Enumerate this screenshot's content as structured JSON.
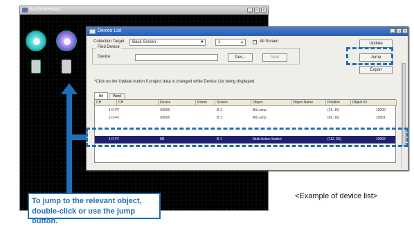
{
  "left_window": {
    "title": "B-1(Front+Back)",
    "controls": [
      "_",
      "□",
      "×"
    ]
  },
  "device_list": {
    "title": "Device List",
    "controls": [
      "_",
      "□",
      "×"
    ],
    "collection_target_label": "Collection Target",
    "collection_target_value": "Base Screen",
    "screen_number": "1",
    "all_screen_label": "All Screen",
    "find_device_label": "Find Device",
    "device_label": "Device",
    "device_value": "",
    "dev_button": "Dev...",
    "next_button": "Next",
    "update_button": "Update",
    "jump_button": "Jump",
    "export_button": "Export",
    "note": "*Click on the Update button if project data is changed while Device List being displayed.",
    "tabs": [
      "Bit",
      "Word"
    ],
    "columns": [
      "CH",
      "Device",
      "Points",
      "Screen",
      "Object",
      "Object Name",
      "Position",
      "Object ID"
    ],
    "rows": [
      [
        "1",
        "D-FF",
        "X0000",
        "",
        "B 1",
        "Bit Lamp",
        "",
        "(16, 16)",
        "10000"
      ],
      [
        "1",
        "D-FF",
        "X0000",
        "",
        "B 1",
        "Bit Lamp",
        "",
        "(66, 16)",
        "10001"
      ],
      [
        "1",
        "D-FF",
        "M1",
        "",
        "B 1",
        "Multi Action Switch",
        "",
        "(112, 66)",
        "10002"
      ]
    ],
    "selected_row": 2
  },
  "callout": {
    "line1": "To jump to the relevant object,",
    "line2": "double-click or use the jump button."
  },
  "caption": "<Example of device list>",
  "colors": {
    "accent": "#1e6fb8",
    "selection": "#1f1f6e"
  }
}
